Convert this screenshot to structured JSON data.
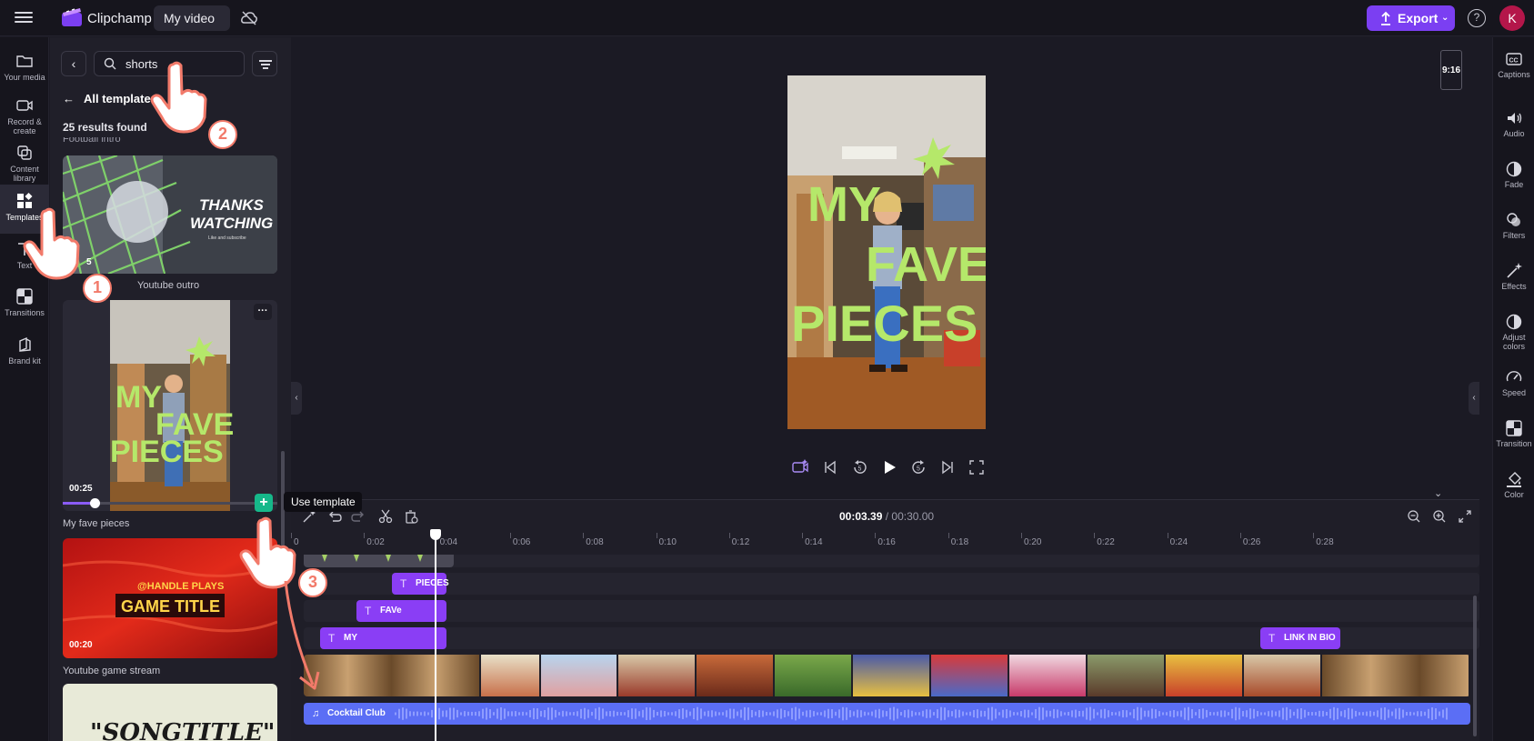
{
  "app": {
    "name": "Clipchamp",
    "project_name": "My video"
  },
  "header": {
    "export_label": "Export",
    "export_chevron": "⌄",
    "help_glyph": "?",
    "avatar_initial": "K"
  },
  "left_nav": {
    "items": [
      {
        "label": "Your media",
        "icon": "folder-icon"
      },
      {
        "label": "Record & create",
        "icon": "camera-icon"
      },
      {
        "label": "Content library",
        "icon": "library-icon"
      },
      {
        "label": "Templates",
        "icon": "templates-icon",
        "active": true
      },
      {
        "label": "Text",
        "icon": "text-icon"
      },
      {
        "label": "Transitions",
        "icon": "transitions-icon"
      },
      {
        "label": "Brand kit",
        "icon": "brand-kit-icon"
      }
    ]
  },
  "templates_panel": {
    "search_value": "shorts",
    "back_glyph": "‹",
    "all_templates_label": "All templates",
    "back_arrow": "←",
    "results_text": "25 results found",
    "clipped_title": "Football intro",
    "cards": [
      {
        "title": "Youtube outro",
        "duration_fragment": "5",
        "art_text_1": "THANKS",
        "art_text_2": "WATCHING",
        "art_small": "Like and subscribe"
      },
      {
        "title": "My fave pieces",
        "duration": "00:25",
        "art_words": [
          "MY",
          "FAVE",
          "PIECES"
        ],
        "progress": 0.15
      },
      {
        "title": "Youtube game stream",
        "duration": "00:20",
        "art_small": "@HANDLE PLAYS",
        "art_title": "GAME TITLE"
      },
      {
        "art_text": "\"SONGTITLE\""
      }
    ],
    "more_glyph": "···",
    "add_glyph": "+",
    "tooltip": "Use template"
  },
  "preview": {
    "aspect_ratio": "9:16",
    "overlay_words": [
      "MY",
      "FAVE",
      "PIECES"
    ],
    "collapse_left_glyph": "‹",
    "collapse_right_glyph": "‹",
    "expand_glyph": "⌄"
  },
  "right_rail": {
    "items": [
      {
        "label": "Captions",
        "icon": "captions-icon"
      },
      {
        "label": "Audio",
        "icon": "audio-icon"
      },
      {
        "label": "Fade",
        "icon": "fade-icon"
      },
      {
        "label": "Filters",
        "icon": "filters-icon"
      },
      {
        "label": "Effects",
        "icon": "effects-icon"
      },
      {
        "label": "Adjust colors",
        "icon": "adjust-colors-icon"
      },
      {
        "label": "Speed",
        "icon": "speed-icon"
      },
      {
        "label": "Transition",
        "icon": "transition-icon"
      },
      {
        "label": "Color",
        "icon": "color-icon"
      }
    ]
  },
  "timeline": {
    "current_time": "00:03.39",
    "separator": " / ",
    "total_time": "00:30.00",
    "ruler_labels": [
      "0",
      "0:02",
      "0:04",
      "0:06",
      "0:08",
      "0:10",
      "0:12",
      "0:14",
      "0:16",
      "0:18",
      "0:20",
      "0:22",
      "0:24",
      "0:26",
      "0:28"
    ],
    "text_clips": [
      {
        "label": "PIECES"
      },
      {
        "label": "FAVe"
      },
      {
        "label": "MY"
      },
      {
        "label": "LINK IN BIO"
      }
    ],
    "text_glyph": "T",
    "audio_clip": "Cocktail Club",
    "audio_glyph": "♫"
  },
  "annotations": {
    "step_1": "1",
    "step_2": "2",
    "step_3": "3"
  },
  "colors": {
    "accent": "#7b3ff2",
    "text_clip": "#8a3ef5",
    "audio_clip": "#5b6ef5",
    "add_button": "#16b88a",
    "overlay_text": "#b5e86a",
    "annotation": "#f27a6a"
  }
}
